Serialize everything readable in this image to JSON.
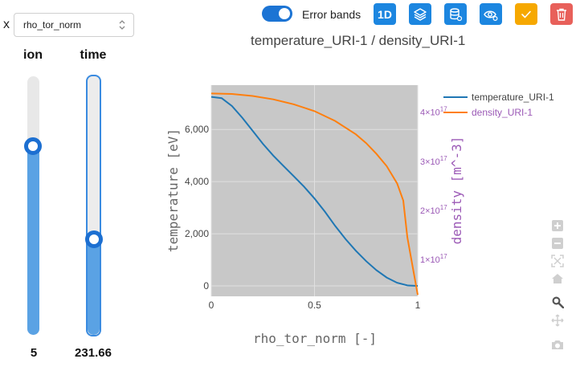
{
  "x_selector": {
    "label": "x",
    "value": "rho_tor_norm"
  },
  "sliders": [
    {
      "title": "ion",
      "value": "5",
      "level": 0.73
    },
    {
      "title": "time",
      "value": "231.66",
      "level": 0.37
    }
  ],
  "toolbar": {
    "error_bands_label": "Error bands",
    "error_bands_on": true,
    "one_d_label": "1D",
    "buttons": [
      "layers-icon",
      "database-icon",
      "eye-settings-icon",
      "check-icon",
      "trash-icon"
    ]
  },
  "colors": {
    "temperature": "#1f77b4",
    "density": "#ff7f0e",
    "accent": "#1c86e0",
    "plot_bg": "#c8c8c8"
  },
  "chart_data": {
    "type": "line",
    "title": "temperature_URI-1 / density_URI-1",
    "xlabel": "rho_tor_norm [-]",
    "ylabel": "temperature [eV]",
    "y2label": "density [m^-3]",
    "xlim": [
      0,
      1
    ],
    "ylim": [
      -400,
      7700
    ],
    "y2lim": [
      2.5e+16,
      4.55e+17
    ],
    "x_ticks": [
      "0",
      "0.5",
      "1"
    ],
    "y_ticks": [
      {
        "value": 0,
        "label": "0"
      },
      {
        "value": 2000,
        "label": "2,000"
      },
      {
        "value": 4000,
        "label": "4,000"
      },
      {
        "value": 6000,
        "label": "6,000"
      }
    ],
    "y2_ticks": [
      {
        "value": 1e+17,
        "base": "1×10",
        "exp": "17"
      },
      {
        "value": 2e+17,
        "base": "2×10",
        "exp": "17"
      },
      {
        "value": 3e+17,
        "base": "3×10",
        "exp": "17"
      },
      {
        "value": 4e+17,
        "base": "4×10",
        "exp": "17"
      }
    ],
    "grid": true,
    "legend_position": "top-right",
    "series": [
      {
        "name": "temperature_URI-1",
        "axis": "y",
        "x": [
          0,
          0.05,
          0.1,
          0.15,
          0.2,
          0.25,
          0.3,
          0.35,
          0.4,
          0.45,
          0.5,
          0.55,
          0.6,
          0.65,
          0.7,
          0.75,
          0.8,
          0.85,
          0.9,
          0.95,
          1.0
        ],
        "y": [
          7250,
          7200,
          6900,
          6450,
          5950,
          5450,
          5000,
          4600,
          4200,
          3800,
          3350,
          2850,
          2300,
          1800,
          1350,
          950,
          600,
          320,
          120,
          20,
          0
        ]
      },
      {
        "name": "density_URI-1",
        "axis": "y2",
        "x": [
          0,
          0.1,
          0.2,
          0.3,
          0.4,
          0.5,
          0.6,
          0.7,
          0.75,
          0.8,
          0.85,
          0.9,
          0.93,
          0.95,
          1.0
        ],
        "y": [
          4.38e+17,
          4.37e+17,
          4.33e+17,
          4.26e+17,
          4.16e+17,
          4.02e+17,
          3.82e+17,
          3.55e+17,
          3.37e+17,
          3.15e+17,
          2.9e+17,
          2.55e+17,
          2.2e+17,
          1.45e+17,
          2.8e+16
        ]
      }
    ]
  }
}
